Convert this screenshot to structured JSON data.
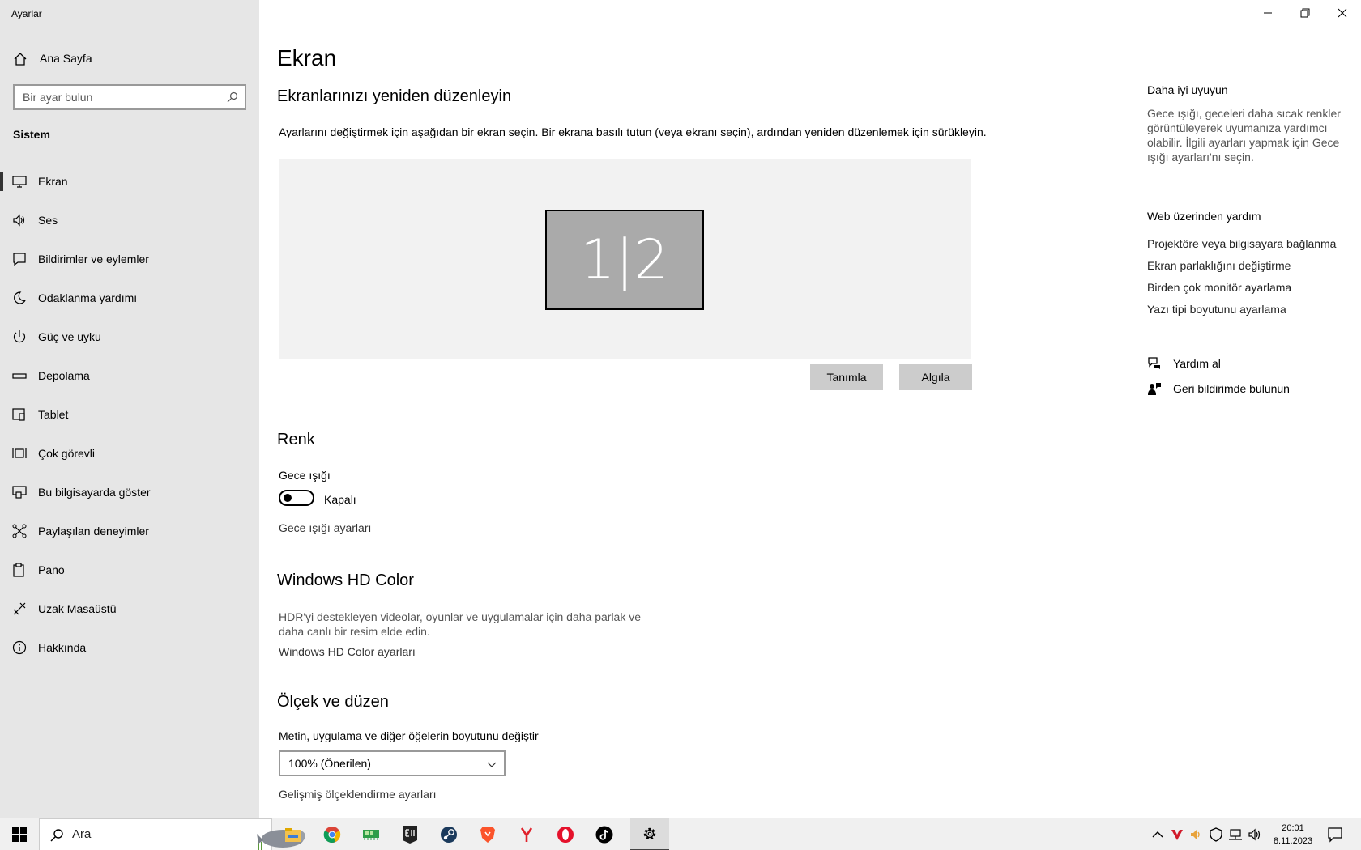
{
  "window": {
    "title": "Ayarlar",
    "controls": [
      "minimize-icon",
      "restore-icon",
      "close-icon"
    ]
  },
  "sidebar": {
    "home_label": "Ana Sayfa",
    "search_placeholder": "Bir ayar bulun",
    "section": "Sistem",
    "items": [
      {
        "label": "Ekran",
        "icon": "monitor-icon",
        "active": true
      },
      {
        "label": "Ses",
        "icon": "speaker-icon"
      },
      {
        "label": "Bildirimler ve eylemler",
        "icon": "notification-icon"
      },
      {
        "label": "Odaklanma yardımı",
        "icon": "moon-icon"
      },
      {
        "label": "Güç ve uyku",
        "icon": "power-icon"
      },
      {
        "label": "Depolama",
        "icon": "storage-icon"
      },
      {
        "label": "Tablet",
        "icon": "tablet-icon"
      },
      {
        "label": "Çok görevli",
        "icon": "multitask-icon"
      },
      {
        "label": "Bu bilgisayarda göster",
        "icon": "project-icon"
      },
      {
        "label": "Paylaşılan deneyimler",
        "icon": "shared-icon"
      },
      {
        "label": "Pano",
        "icon": "clipboard-icon"
      },
      {
        "label": "Uzak Masaüstü",
        "icon": "remote-icon"
      },
      {
        "label": "Hakkında",
        "icon": "info-icon"
      }
    ]
  },
  "main": {
    "title": "Ekran",
    "arrange": {
      "heading": "Ekranlarınızı yeniden düzenleyin",
      "description": "Ayarlarını değiştirmek için aşağıdan bir ekran seçin. Bir ekrana basılı tutun (veya ekranı seçin), ardından yeniden düzenlemek için sürükleyin.",
      "monitor_label": "1|2",
      "identify_button": "Tanımla",
      "detect_button": "Algıla"
    },
    "color": {
      "heading": "Renk",
      "night_light_label": "Gece ışığı",
      "toggle_state": "Kapalı",
      "night_light_settings": "Gece ışığı ayarları"
    },
    "hdr": {
      "heading": "Windows HD Color",
      "description_line1": "HDR'yi destekleyen videolar, oyunlar ve uygulamalar için daha parlak ve",
      "description_line2": "daha canlı bir resim elde edin.",
      "settings_link": "Windows HD Color ayarları"
    },
    "scale": {
      "heading": "Ölçek ve düzen",
      "size_label": "Metin, uygulama ve diğer öğelerin boyutunu değiştir",
      "size_value": "100% (Önerilen)",
      "advanced_link": "Gelişmiş ölçeklendirme ayarları"
    }
  },
  "right_pane": {
    "sleep_heading": "Daha iyi uyuyun",
    "sleep_text": "Gece ışığı, geceleri daha sıcak renkler görüntüleyerek uyumanıza yardımcı olabilir. İlgili ayarları yapmak için Gece ışığı ayarları'nı seçin.",
    "web_help_heading": "Web üzerinden yardım",
    "links": [
      "Projektöre veya bilgisayara bağlanma",
      "Ekran parlaklığını değiştirme",
      "Birden çok monitör ayarlama",
      "Yazı tipi boyutunu ayarlama"
    ],
    "get_help": "Yardım al",
    "feedback": "Geri bildirimde bulunun"
  },
  "taskbar": {
    "search_text": "Ara",
    "apps": [
      "file-explorer-icon",
      "chrome-icon",
      "memory-icon",
      "epic-games-icon",
      "steam-icon",
      "brave-icon",
      "yandex-icon",
      "opera-icon",
      "tiktok-icon",
      "settings-icon"
    ],
    "tray": [
      "chevron-up-icon",
      "antivirus-icon",
      "volume-icon",
      "security-icon",
      "network-icon",
      "speaker-icon"
    ],
    "time": "20:01",
    "date": "8.11.2023"
  },
  "colors": {
    "sidebar_bg": "#e6e6e6",
    "canvas_bg": "#f2f2f2",
    "monitor_fill": "#aaaaaa",
    "button_bg": "#cccccc"
  }
}
